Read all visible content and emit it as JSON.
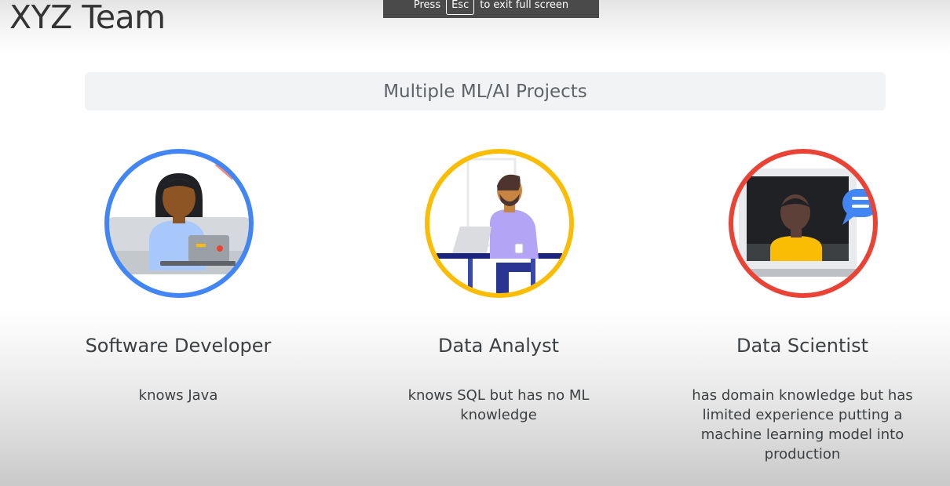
{
  "slide": {
    "title": "XYZ Team",
    "banner": "Multiple ML/AI Projects"
  },
  "fullscreen_toast": {
    "prefix": "Press",
    "key": "Esc",
    "suffix": "to exit full screen"
  },
  "roles": [
    {
      "title": "Software Developer",
      "description": "knows Java",
      "ring_color": "#4285f4",
      "icon": "developer-illustration-icon"
    },
    {
      "title": "Data Analyst",
      "description": "knows SQL but has no ML knowledge",
      "ring_color": "#fbbc04",
      "icon": "analyst-illustration-icon"
    },
    {
      "title": "Data Scientist",
      "description": "has domain knowledge but has limited experience putting a machine learning model into production",
      "ring_color": "#ea4335",
      "icon": "scientist-illustration-icon"
    }
  ]
}
